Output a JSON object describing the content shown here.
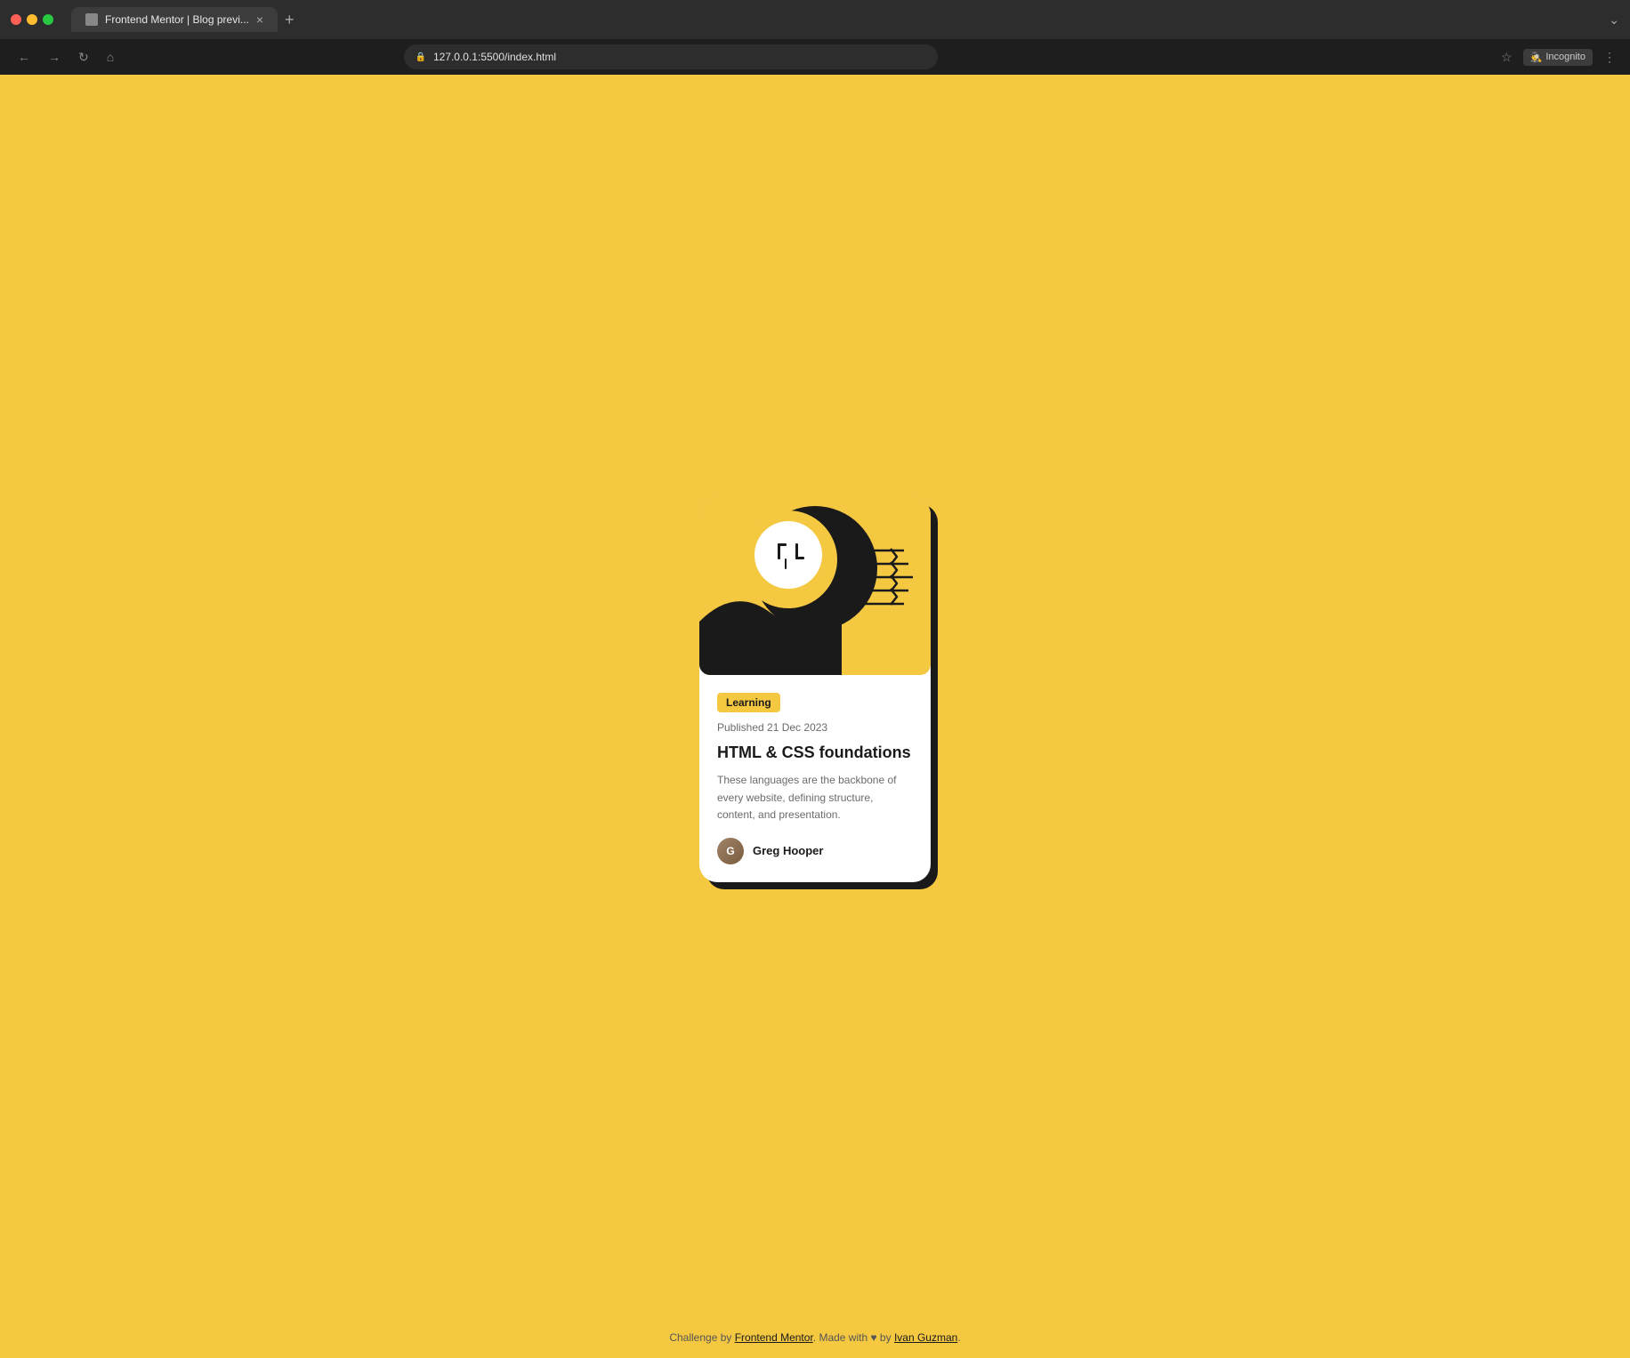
{
  "browser": {
    "tab_title": "Frontend Mentor | Blog previ...",
    "url": "127.0.0.1:5500/index.html",
    "incognito_label": "Incognito",
    "new_tab_label": "+",
    "tab_close_label": "×"
  },
  "page": {
    "background_color": "#f5c842"
  },
  "card": {
    "tag": "Learning",
    "tag_bg": "#f5c842",
    "date": "Published 21 Dec 2023",
    "title": "HTML & CSS foundations",
    "description": "These languages are the backbone of every website, defining structure, content, and presentation.",
    "author_name": "Greg Hooper"
  },
  "footer": {
    "text_before_link": "Challenge by ",
    "link1_label": "Frontend Mentor",
    "link1_url": "#",
    "text_middle": ". Made with ♥ by ",
    "link2_label": "Ivan Guzman",
    "link2_url": "#",
    "text_end": "."
  }
}
